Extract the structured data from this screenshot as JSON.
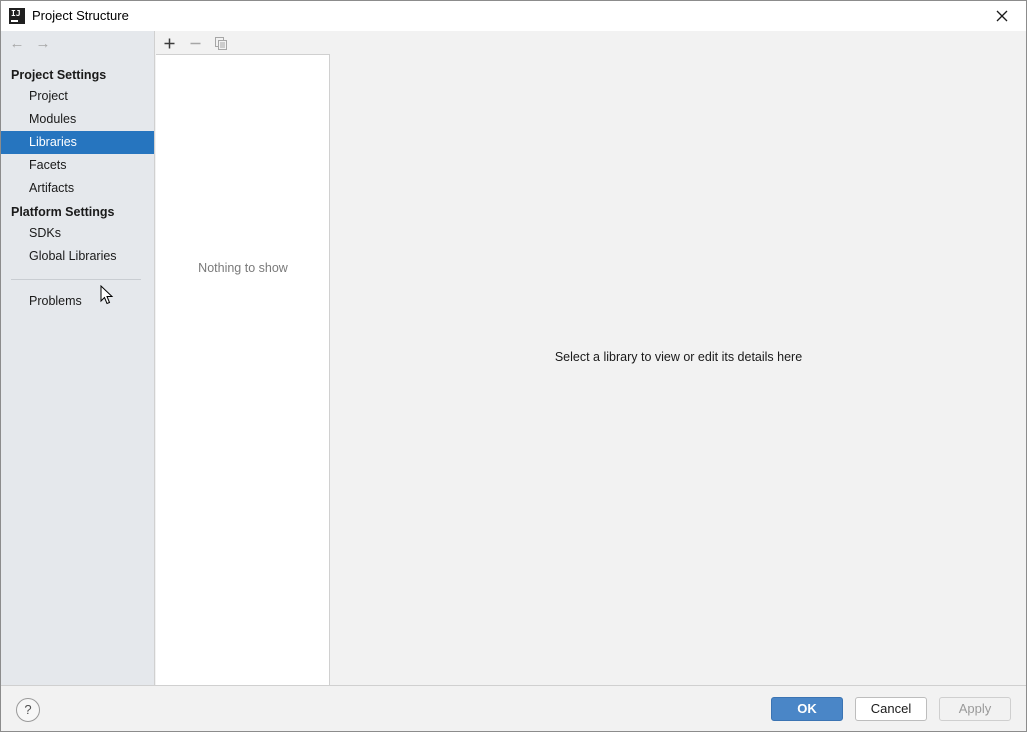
{
  "window": {
    "title": "Project Structure",
    "icon": "intellij-idea-icon",
    "icon_text": "IJ"
  },
  "sidebar": {
    "back_icon": "←",
    "forward_icon": "→",
    "groups": [
      {
        "label": "Project Settings"
      },
      {
        "label": "Platform Settings"
      }
    ],
    "items": [
      {
        "label": "Project"
      },
      {
        "label": "Modules"
      },
      {
        "label": "Libraries",
        "selected": true
      },
      {
        "label": "Facets"
      },
      {
        "label": "Artifacts"
      },
      {
        "label": "SDKs"
      },
      {
        "label": "Global Libraries"
      },
      {
        "label": "Problems"
      }
    ],
    "selected_color": "#2675bf"
  },
  "list_panel": {
    "toolbar": {
      "add_icon": "plus-icon",
      "remove_icon": "minus-icon",
      "copy_icon": "copy-icon"
    },
    "empty_text": "Nothing to show"
  },
  "details": {
    "placeholder_text": "Select a library to view or edit its details here"
  },
  "footer": {
    "help_label": "?",
    "ok_label": "OK",
    "cancel_label": "Cancel",
    "apply_label": "Apply",
    "ok_color": "#4a86c7"
  }
}
